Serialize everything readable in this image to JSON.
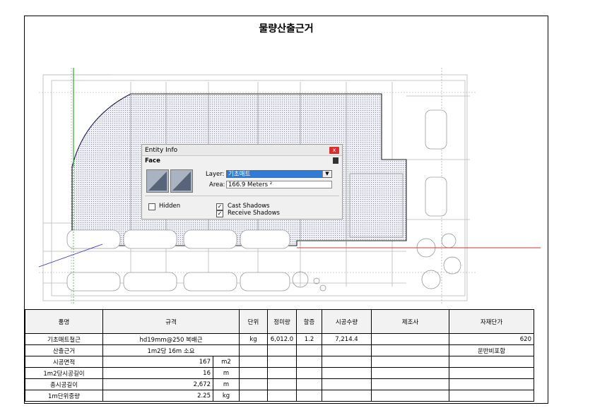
{
  "title": "물량산출근거",
  "entity_info": {
    "window_title": "Entity Info",
    "close_label": "x",
    "type": "Face",
    "layer_label": "Layer:",
    "layer_value": "기초매트",
    "area_label": "Area:",
    "area_value": "166.9 Meters ²",
    "hidden_label": "Hidden",
    "cast_shadows_label": "Cast Shadows",
    "receive_shadows_label": "Receive Shadows",
    "hidden_checked": false,
    "cast_shadows_checked": true,
    "receive_shadows_checked": true
  },
  "table": {
    "headers": [
      "품명",
      "규격",
      "단위",
      "정미량",
      "할증",
      "시공수량",
      "제조사",
      "자재단가"
    ],
    "row1": {
      "name": "기초매트철근",
      "spec": "hd19mm@250 복배근",
      "unit": "kg",
      "net": "6,012.0",
      "extra": "1.2",
      "qty": "7,214.4",
      "maker": "",
      "price": "620"
    },
    "row2": {
      "name": "산출근거",
      "spec": "1m2당 16m 소요",
      "price": "운반비포함"
    },
    "rows": [
      {
        "name": "시공면적",
        "value": "167",
        "unit": "m2"
      },
      {
        "name": "1m2당시공길이",
        "value": "16",
        "unit": "m"
      },
      {
        "name": "총시공길이",
        "value": "2,672",
        "unit": "m"
      },
      {
        "name": "1m단위중량",
        "value": "2.25",
        "unit": "kg"
      }
    ]
  }
}
